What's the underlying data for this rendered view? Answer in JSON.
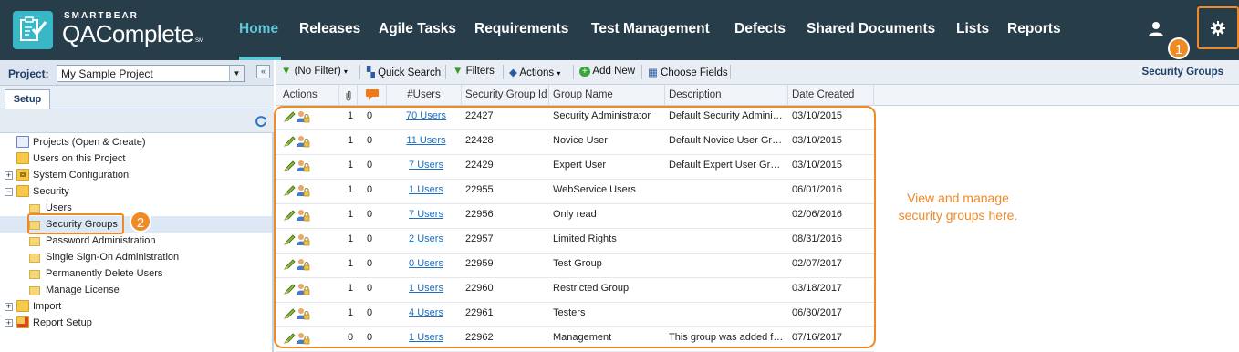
{
  "app": {
    "brand_small": "SMARTBEAR",
    "brand_big": "QAComplete",
    "brand_sm": "SM",
    "logo_icon": "clipboard-check-icon"
  },
  "nav": {
    "items": [
      {
        "label": "Home",
        "active": true
      },
      {
        "label": "Releases"
      },
      {
        "label": "Agile Tasks"
      },
      {
        "label": "Requirements"
      },
      {
        "label": "Test Management"
      },
      {
        "label": "Defects"
      },
      {
        "label": "Shared Documents"
      },
      {
        "label": "Lists"
      },
      {
        "label": "Reports"
      }
    ],
    "user_icon": "user-icon",
    "settings_icon": "gear-icon"
  },
  "callouts": {
    "one": "1",
    "two": "2"
  },
  "project": {
    "label": "Project:",
    "value": "My Sample Project"
  },
  "tabs": {
    "setup": "Setup"
  },
  "tree": [
    {
      "label": "Projects (Open & Create)",
      "icon": "projects-icon",
      "level": 0,
      "expander": ""
    },
    {
      "label": "Users on this Project",
      "icon": "folder-icon",
      "level": 0,
      "expander": ""
    },
    {
      "label": "System Configuration",
      "icon": "gear-folder-icon",
      "level": 0,
      "expander": "+"
    },
    {
      "label": "Security",
      "icon": "folder-icon",
      "level": 0,
      "expander": "−"
    },
    {
      "label": "Users",
      "icon": "lock-icon",
      "level": 1,
      "expander": ""
    },
    {
      "label": "Security Groups",
      "icon": "lock-icon",
      "level": 1,
      "expander": "",
      "selected": true
    },
    {
      "label": "Password Administration",
      "icon": "lock-icon",
      "level": 1,
      "expander": ""
    },
    {
      "label": "Single Sign-On Administration",
      "icon": "lock-icon",
      "level": 1,
      "expander": ""
    },
    {
      "label": "Permanently Delete Users",
      "icon": "lock-icon",
      "level": 1,
      "expander": ""
    },
    {
      "label": "Manage License",
      "icon": "lock-icon",
      "level": 1,
      "expander": ""
    },
    {
      "label": "Import",
      "icon": "folder-icon",
      "level": 0,
      "expander": "+"
    },
    {
      "label": "Report Setup",
      "icon": "report-folder-icon",
      "level": 0,
      "expander": "+"
    }
  ],
  "toolbar": {
    "filter": "(No Filter)",
    "quick_search": "Quick Search",
    "filters": "Filters",
    "actions": "Actions",
    "add_new": "Add New",
    "choose_fields": "Choose Fields",
    "title": "Security Groups"
  },
  "columns": {
    "actions": "Actions",
    "attachments_icon": "paperclip-icon",
    "notes_icon": "comment-icon",
    "users": "#Users",
    "id": "Security Group Id",
    "name": "Group Name",
    "description": "Description",
    "date": "Date Created"
  },
  "groups": [
    {
      "attach": "1",
      "notes": "0",
      "users": "70 Users",
      "id": "22427",
      "name": "Security Administrator",
      "description": "Default Security Admini…",
      "date": "03/10/2015"
    },
    {
      "attach": "1",
      "notes": "0",
      "users": "11 Users",
      "id": "22428",
      "name": "Novice User",
      "description": "Default Novice User Gr…",
      "date": "03/10/2015"
    },
    {
      "attach": "1",
      "notes": "0",
      "users": "7 Users",
      "id": "22429",
      "name": "Expert User",
      "description": "Default Expert User Gr…",
      "date": "03/10/2015"
    },
    {
      "attach": "1",
      "notes": "0",
      "users": "1 Users",
      "id": "22955",
      "name": "WebService Users",
      "description": "",
      "date": "06/01/2016"
    },
    {
      "attach": "1",
      "notes": "0",
      "users": "7 Users",
      "id": "22956",
      "name": "Only read",
      "description": "",
      "date": "02/06/2016"
    },
    {
      "attach": "1",
      "notes": "0",
      "users": "2 Users",
      "id": "22957",
      "name": "Limited Rights",
      "description": "",
      "date": "08/31/2016"
    },
    {
      "attach": "1",
      "notes": "0",
      "users": "0 Users",
      "id": "22959",
      "name": "Test Group",
      "description": "",
      "date": "02/07/2017"
    },
    {
      "attach": "1",
      "notes": "0",
      "users": "1 Users",
      "id": "22960",
      "name": "Restricted Group",
      "description": "",
      "date": "03/18/2017"
    },
    {
      "attach": "1",
      "notes": "0",
      "users": "4 Users",
      "id": "22961",
      "name": "Testers",
      "description": "",
      "date": "06/30/2017"
    },
    {
      "attach": "0",
      "notes": "0",
      "users": "1 Users",
      "id": "22962",
      "name": "Management",
      "description": "This group was added f…",
      "date": "07/16/2017"
    }
  ],
  "annotation": "View and manage security groups here.",
  "colors": {
    "header_bg": "#273d4a",
    "accent": "#5fc6d6",
    "callout": "#f08a24",
    "link": "#1a6fc2"
  }
}
